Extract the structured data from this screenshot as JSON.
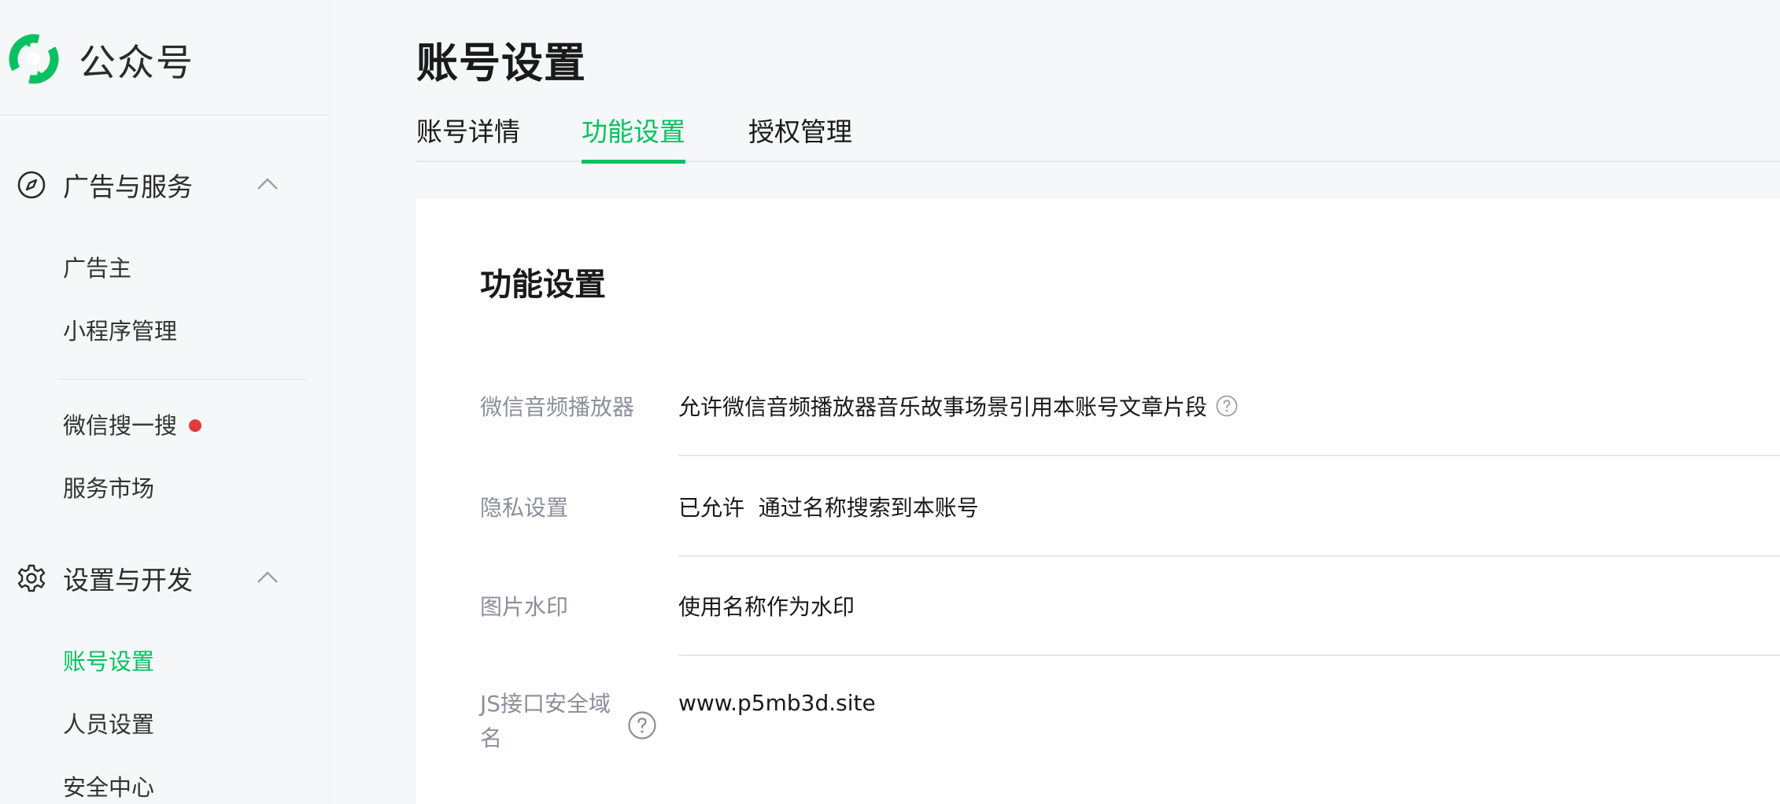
{
  "brand": {
    "name": "公众号",
    "color": "#07c160",
    "icon": "wechat-official-logo-icon"
  },
  "sidebar": {
    "groups": [
      {
        "label": "广告与服务",
        "icon": "compass-icon",
        "expanded": true,
        "items": [
          "广告主",
          "小程序管理",
          "微信搜一搜",
          "服务市场"
        ]
      },
      {
        "label": "设置与开发",
        "icon": "gear-icon",
        "expanded": true,
        "items": [
          "账号设置",
          "人员设置",
          "安全中心"
        ]
      }
    ],
    "active_item": "账号设置",
    "badge_item": "微信搜一搜"
  },
  "header": {
    "title": "账号设置"
  },
  "tabs": [
    {
      "label": "账号详情",
      "active": false
    },
    {
      "label": "功能设置",
      "active": true
    },
    {
      "label": "授权管理",
      "active": false
    }
  ],
  "card": {
    "title": "功能设置",
    "rows": [
      {
        "label": "微信音频播放器",
        "value": "允许微信音频播放器音乐故事场景引用本账号文章片段",
        "has_help": true
      },
      {
        "label": "隐私设置",
        "value": "已允许  通过名称搜索到本账号"
      },
      {
        "label": "图片水印",
        "value": "使用名称作为水印"
      },
      {
        "label_line1": "JS接口安全域",
        "label_line2": "名",
        "value": "www.p5mb3d.site",
        "has_help": true
      }
    ]
  },
  "colors": {
    "accent": "#07c160",
    "badge": "#e33b3b",
    "muted": "#8a8f99"
  }
}
